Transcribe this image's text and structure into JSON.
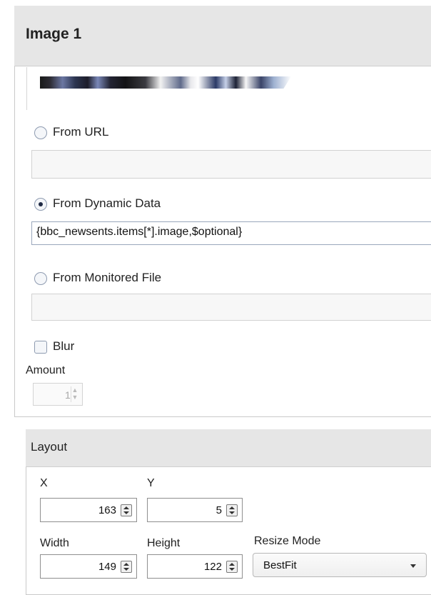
{
  "image_panel": {
    "title": "Image 1",
    "source_options": [
      {
        "label": "From URL",
        "selected": false,
        "value": ""
      },
      {
        "label": "From Dynamic Data",
        "selected": true,
        "value": "{bbc_newsents.items[*].image,$optional}"
      },
      {
        "label": "From Monitored File",
        "selected": false,
        "value": ""
      }
    ],
    "blur": {
      "label": "Blur",
      "checked": false
    },
    "amount": {
      "label": "Amount",
      "value": "1"
    }
  },
  "layout_panel": {
    "title": "Layout",
    "x": {
      "label": "X",
      "value": "163"
    },
    "y": {
      "label": "Y",
      "value": "5"
    },
    "width": {
      "label": "Width",
      "value": "149"
    },
    "height": {
      "label": "Height",
      "value": "122"
    },
    "resize_mode": {
      "label": "Resize Mode",
      "value": "BestFit"
    }
  },
  "icons": {
    "radio": "radio-button-icon",
    "checkbox": "checkbox-icon",
    "spinner": "spinner-arrows-icon",
    "dropdown": "chevron-down-icon"
  }
}
